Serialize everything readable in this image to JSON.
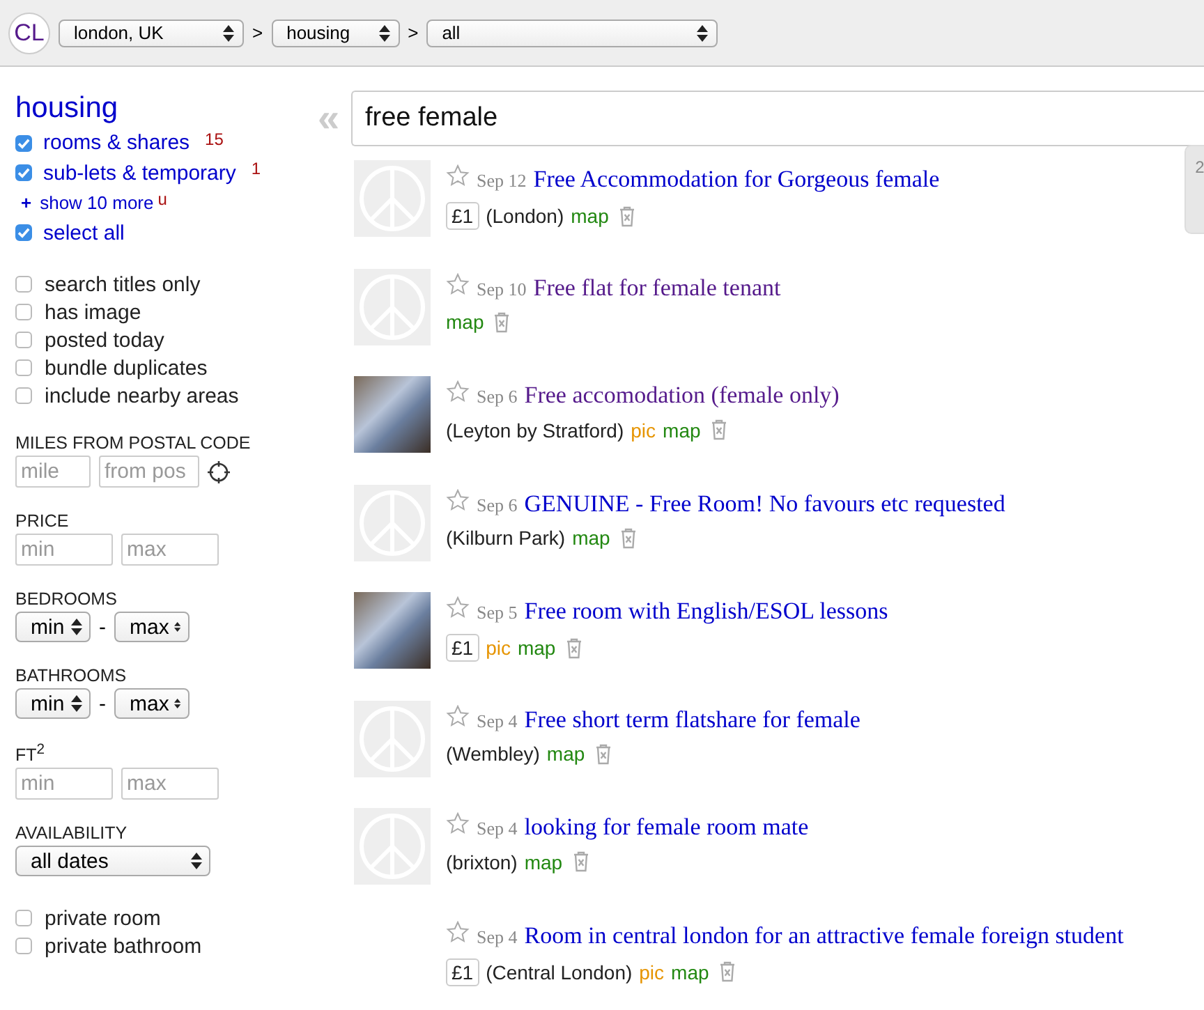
{
  "header": {
    "logo": "CL",
    "breadcrumbs": [
      {
        "value": "london, UK"
      },
      {
        "value": "housing"
      },
      {
        "value": "all"
      }
    ],
    "separator": ">"
  },
  "sidebar": {
    "heading": "housing",
    "categories": [
      {
        "kind": "check",
        "label": "rooms & shares",
        "count": "15",
        "checked": true
      },
      {
        "kind": "check",
        "label": "sub-lets & temporary",
        "count": "1",
        "checked": true
      },
      {
        "kind": "more",
        "label": "show 10 more",
        "prefix": "+",
        "count": "u"
      },
      {
        "kind": "check",
        "label": "select all",
        "checked": true
      }
    ],
    "options": [
      {
        "label": "search titles only",
        "checked": false
      },
      {
        "label": "has image",
        "checked": false
      },
      {
        "label": "posted today",
        "checked": false
      },
      {
        "label": "bundle duplicates",
        "checked": false
      },
      {
        "label": "include nearby areas",
        "checked": false
      }
    ],
    "filters": [
      {
        "kind": "postal",
        "label": "MILES FROM POSTAL CODE",
        "fields": [
          {
            "placeholder": "mile"
          },
          {
            "placeholder": "from pos"
          }
        ]
      },
      {
        "kind": "inputs",
        "label": "PRICE",
        "fields": [
          {
            "placeholder": "min"
          },
          {
            "placeholder": "max"
          }
        ]
      },
      {
        "kind": "range",
        "label": "BEDROOMS",
        "min": "min",
        "dash": "-",
        "max": "max"
      },
      {
        "kind": "range",
        "label": "BATHROOMS",
        "min": "min",
        "dash": "-",
        "max": "max"
      },
      {
        "kind": "inputs",
        "label": "FT$^{2}$",
        "fields": [
          {
            "placeholder": "min"
          },
          {
            "placeholder": "max"
          }
        ]
      },
      {
        "kind": "select",
        "label": "AVAILABILITY",
        "value": "all dates"
      }
    ],
    "extras": [
      {
        "label": "private room",
        "checked": false
      },
      {
        "label": "private bathroom",
        "checked": false
      }
    ]
  },
  "search": {
    "collapse": "«",
    "query": "free female"
  },
  "side_widget": {
    "count": "2"
  },
  "listings": [
    {
      "kind": "placeholder",
      "date": "Sep 12",
      "title": "Free Accommodation for Gorgeous female",
      "visited": false,
      "price": "£1",
      "location": "(London)",
      "map": "map"
    },
    {
      "kind": "placeholder",
      "date": "Sep 10",
      "title": "Free flat for female tenant",
      "visited": true,
      "map": "map"
    },
    {
      "kind": "photo",
      "date": "Sep 6",
      "title": "Free accomodation (female only)",
      "visited": true,
      "location": "(Leyton by Stratford)",
      "pic": "pic",
      "map": "map"
    },
    {
      "kind": "placeholder",
      "date": "Sep 6",
      "title": "GENUINE - Free Room! No favours etc requested",
      "visited": false,
      "location": "(Kilburn Park)",
      "map": "map"
    },
    {
      "kind": "photo",
      "date": "Sep 5",
      "title": "Free room with English/ESOL lessons",
      "visited": false,
      "price": "£1",
      "pic": "pic",
      "map": "map"
    },
    {
      "kind": "placeholder",
      "date": "Sep 4",
      "title": "Free short term flatshare for female",
      "visited": false,
      "location": "(Wembley)",
      "map": "map"
    },
    {
      "kind": "placeholder",
      "date": "Sep 4",
      "title": "looking for female room mate",
      "visited": false,
      "location": "(brixton)",
      "map": "map"
    },
    {
      "kind": "no-image",
      "date": "Sep 4",
      "title": "Room in central london for an attractive female foreign student",
      "visited": false,
      "price": "£1",
      "location": "(Central London)",
      "pic": "pic",
      "map": "map"
    }
  ]
}
